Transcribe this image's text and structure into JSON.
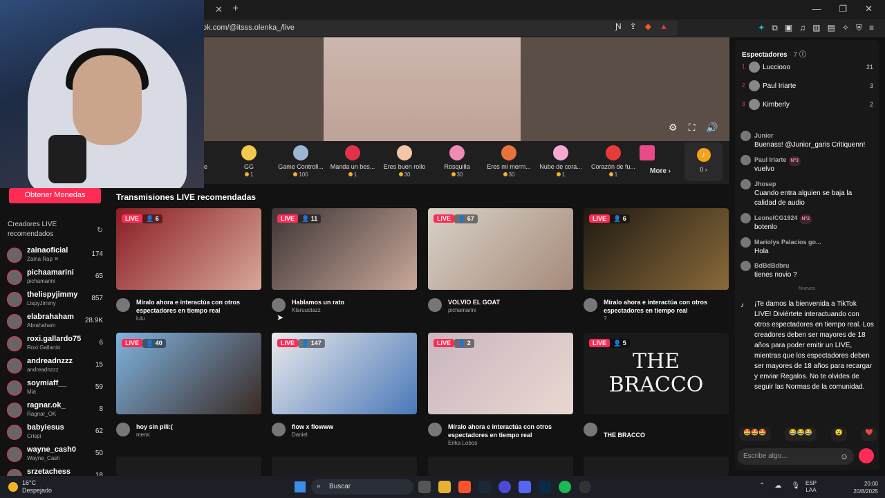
{
  "browser": {
    "url": "tok.com/@itsss.olenka_/live",
    "tab_close": "✕",
    "tab_new": "+",
    "window_controls": [
      "—",
      "❐",
      "✕"
    ]
  },
  "gifts": [
    {
      "name": "",
      "price": "",
      "color": "#7a6cc9"
    },
    {
      "name": "GG",
      "price": "1",
      "color": "#f2c94c"
    },
    {
      "name": "Game Controll...",
      "price": "100",
      "color": "#9bb7d4"
    },
    {
      "name": "Manda un bes...",
      "price": "1",
      "color": "#e0334a"
    },
    {
      "name": "Eres buen rollo",
      "price": "30",
      "color": "#f3c6a5"
    },
    {
      "name": "Rosquilla",
      "price": "30",
      "color": "#f08bb4"
    },
    {
      "name": "Eres mi merm...",
      "price": "30",
      "color": "#e8733a"
    },
    {
      "name": "Nube de cora...",
      "price": "1",
      "color": "#f7a8d0"
    },
    {
      "name": "Corazón de fu...",
      "price": "1",
      "color": "#e93a3a"
    },
    {
      "name": "",
      "price": "",
      "color": "#e84a8a"
    }
  ],
  "gift_partial_label": "ible",
  "gift_more": "More ›",
  "coin_balance": "0 ›",
  "sidebar": {
    "buy_coins": "Obtener Monedas",
    "creators_title": "Creadores LIVE recomendados",
    "creators": [
      {
        "name": "zainaoficial",
        "sub": "Zaina Rap ✕",
        "count": "174"
      },
      {
        "name": "pichaamarini",
        "sub": "pichamarini",
        "count": "65"
      },
      {
        "name": "thelispyjimmy",
        "sub": "LispyJimmy",
        "count": "857"
      },
      {
        "name": "elabrahaham",
        "sub": "Abrahaham",
        "count": "28.9K"
      },
      {
        "name": "roxi.gallardo75",
        "sub": "Roxi Gallardo",
        "count": "6"
      },
      {
        "name": "andreadnzzz",
        "sub": "andreadnzzz",
        "count": "15"
      },
      {
        "name": "soymiaff__",
        "sub": "Mia",
        "count": "59"
      },
      {
        "name": "ragnar.ok_",
        "sub": "Ragnar_OK",
        "count": "8"
      },
      {
        "name": "babyiesus",
        "sub": "Crispi",
        "count": "62"
      },
      {
        "name": "wayne_cash0",
        "sub": "Wayne_Cash",
        "count": "50"
      },
      {
        "name": "srzetachess",
        "sub": "",
        "count": "18"
      }
    ]
  },
  "main": {
    "title": "Transmisiones LIVE recomendadas",
    "live_label": "LIVE",
    "cards": [
      {
        "viewers": "6",
        "title": "Míralo ahora e interactúa con otros espectadores en tiempo real",
        "user": "lulu",
        "bg": "linear-gradient(135deg,#8a1c22,#d8a89a)"
      },
      {
        "viewers": "11",
        "title": "Hablamos un rato",
        "user": "Klaruudiazz",
        "bg": "linear-gradient(135deg,#3d3434,#c9a89a)"
      },
      {
        "viewers": "67",
        "title": "VOLVIO EL GOAT",
        "user": "pichamarini",
        "bg": "linear-gradient(135deg,#d8d2c8,#a68a7a)"
      },
      {
        "viewers": "6",
        "title": "Míralo ahora e interactúa con otros espectadores en tiempo real",
        "user": "?",
        "bg": "linear-gradient(135deg,#1e1a12,#8a6a3a)"
      },
      {
        "viewers": "40",
        "title": "hoy sin pili:(",
        "user": "memi",
        "bg": "linear-gradient(135deg,#7fb3e0,#3a2a24)"
      },
      {
        "viewers": "147",
        "title": "flow x flowww",
        "user": "Daniel",
        "bg": "linear-gradient(135deg,#e9e9ec,#4a78b8)"
      },
      {
        "viewers": "2",
        "title": "Míralo ahora e interactúa con otros espectadores en tiempo real",
        "user": "Erika Lobos",
        "bg": "linear-gradient(135deg,#c9b6c0,#e9d8d0)"
      },
      {
        "viewers": "5",
        "title": "THE BRACCO",
        "user": "",
        "bg": "#1a1a1a"
      }
    ],
    "bracco_art": "THE BRACCO"
  },
  "chat": {
    "header": "Espectadores",
    "header_count": "· 7",
    "viewers": [
      {
        "rank": "1",
        "name": "Lucciooo",
        "count": "21"
      },
      {
        "rank": "2",
        "name": "Paul Iriarte",
        "count": "3"
      },
      {
        "rank": "3",
        "name": "Kimberly",
        "count": "2"
      }
    ],
    "messages": [
      {
        "user": "Junior",
        "badge": "",
        "text": "Buenass! @Junior_garis Critiquenn!"
      },
      {
        "user": "Paul Iriarte",
        "badge": "Nº3",
        "text": "vuelvo"
      },
      {
        "user": "Jhosep",
        "badge": "",
        "text": "Cuando entra alguien se baja la calidad de audio"
      },
      {
        "user": "LeonelCG1924",
        "badge": "Nº2",
        "text": "botenlo"
      },
      {
        "user": "Mariolys Palacios go...",
        "badge": "",
        "text": "Hola"
      },
      {
        "user": "BdBdBdbru",
        "badge": "",
        "text": "tienes novio ?"
      }
    ],
    "nuevos": "Nuevos",
    "welcome": "¡Te damos la bienvenida a TikTok LIVE! Diviértete interactuando con otros espectadores en tiempo real. Los creadores deben ser mayores de 18 años para poder emitir un LIVE, mientras que los espectadores deben ser mayores de 18 años para recargar y enviar Regalos. No te olvides de seguir las Normas de la comunidad.",
    "quick_reactions": [
      "🤩🤩🤩",
      "😂😂😂",
      "😮",
      "❤️"
    ],
    "input_placeholder": "Escribe algo..."
  },
  "taskbar": {
    "temp": "16°C",
    "condition": "Despejado",
    "search": "Buscar",
    "lang_top": "ESP",
    "lang_bottom": "LAA",
    "time": "20:00",
    "date": "20/8/2025"
  }
}
